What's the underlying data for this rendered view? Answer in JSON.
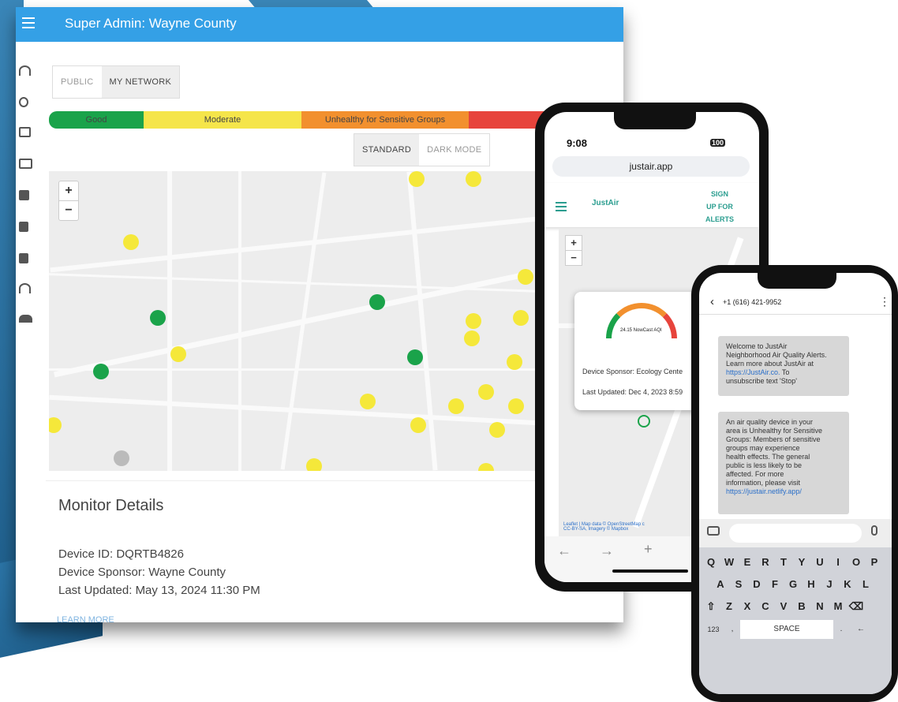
{
  "dashboard": {
    "title": "Super Admin: Wayne County",
    "view_tabs": [
      "PUBLIC",
      "MY NETWORK"
    ],
    "active_view_tab": "MY NETWORK",
    "aqi_legend": [
      {
        "label": "Good",
        "color": "#1aa34a"
      },
      {
        "label": "Moderate",
        "color": "#f5e54a"
      },
      {
        "label": "Unhealthy for Sensitive Groups",
        "color": "#f2902e"
      },
      {
        "label": "",
        "color": "#e7443c"
      }
    ],
    "map_style_tabs": [
      "STANDARD",
      "DARK MODE"
    ],
    "active_map_style": "STANDARD",
    "zoom_in": "+",
    "zoom_out": "−",
    "monitor_details": {
      "heading": "Monitor Details",
      "device_id": "Device ID: DQRTB4826",
      "device_sponsor": "Device Sponsor: Wayne County",
      "last_updated": "Last Updated: May 13, 2024 11:30 PM",
      "learn_more": "LEARN MORE"
    }
  },
  "phone1": {
    "time": "9:08",
    "battery": "100",
    "url": "justair.app",
    "logo_text": "JustAir",
    "signup": [
      "SIGN",
      "UP FOR",
      "ALERTS"
    ],
    "zoom_in": "+",
    "zoom_out": "−",
    "gauge_label": "24.15 NowCast AQI",
    "popup_sponsor": "Device Sponsor: Ecology Cente",
    "popup_updated": "Last Updated: Dec 4, 2023 8:59",
    "attribution": [
      "Leaflet | Map data © OpenStreetMap c",
      "CC-BY-SA, Imagery © Mapbox"
    ]
  },
  "phone2": {
    "phone_number": "+1 (616) 421-9952",
    "message1": [
      "Welcome to JustAir",
      "Neighborhood Air Quality Alerts.",
      "Learn more about JustAir at",
      "https://JustAir.co.",
      "To",
      "unsubscribe text 'Stop'"
    ],
    "message2": [
      "An air quality device in your",
      "area is Unhealthy for Sensitive",
      "Groups: Members of sensitive",
      "groups may experience",
      "health effects. The general",
      "public is less likely to be",
      "affected. For more",
      "information, please visit",
      "https://justair.netlify.app/"
    ],
    "keyboard_row1": [
      "Q",
      "W",
      "E",
      "R",
      "T",
      "Y",
      "U",
      "I",
      "O",
      "P"
    ],
    "keyboard_row2": [
      "A",
      "S",
      "D",
      "F",
      "G",
      "H",
      "J",
      "K",
      "L"
    ],
    "keyboard_row3": [
      "Z",
      "X",
      "C",
      "V",
      "B",
      "N",
      "M"
    ],
    "key_123": "123",
    "key_space": "SPACE"
  }
}
